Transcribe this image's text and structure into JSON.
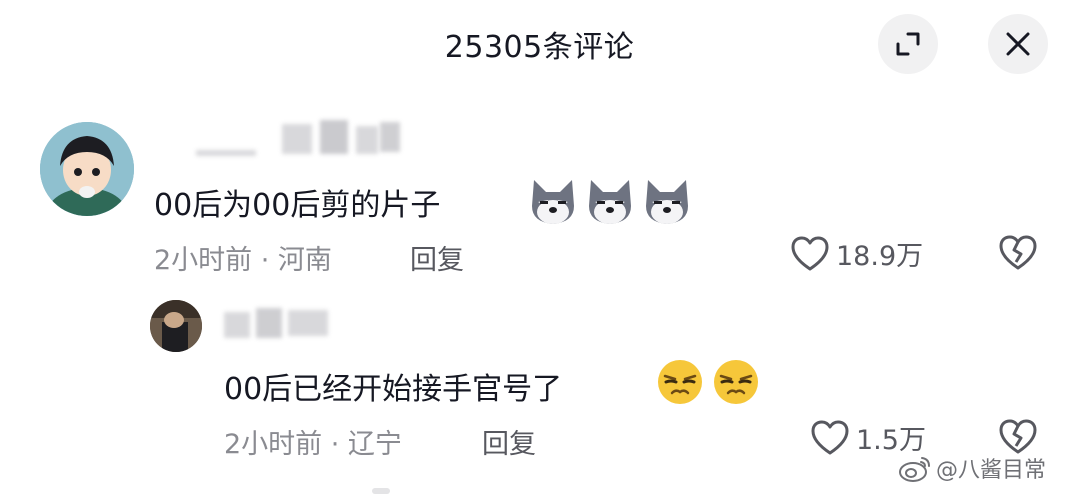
{
  "header": {
    "title": "25305条评论"
  },
  "comments": [
    {
      "text": "00后为00后剪的片子",
      "emoji": [
        "dog-emoji",
        "dog-emoji",
        "dog-emoji"
      ],
      "meta": "2小时前 · 河南",
      "reply_label": "回复",
      "like_count": "18.9万"
    },
    {
      "text": "00后已经开始接手官号了",
      "emoji": [
        "smirk-emoji",
        "smirk-emoji"
      ],
      "meta": "2小时前 · 辽宁",
      "reply_label": "回复",
      "like_count": "1.5万"
    }
  ],
  "watermark": {
    "text": "@八酱目常"
  },
  "icons": {
    "minimize": "minimize-icon",
    "close": "close-icon",
    "like": "heart-icon",
    "dislike": "broken-heart-icon",
    "watermark": "weibo-icon"
  },
  "colors": {
    "text": "#161823",
    "muted": "#8a8b91",
    "button_bg": "#f1f1f2",
    "emoji_yellow": "#f6c73a"
  }
}
